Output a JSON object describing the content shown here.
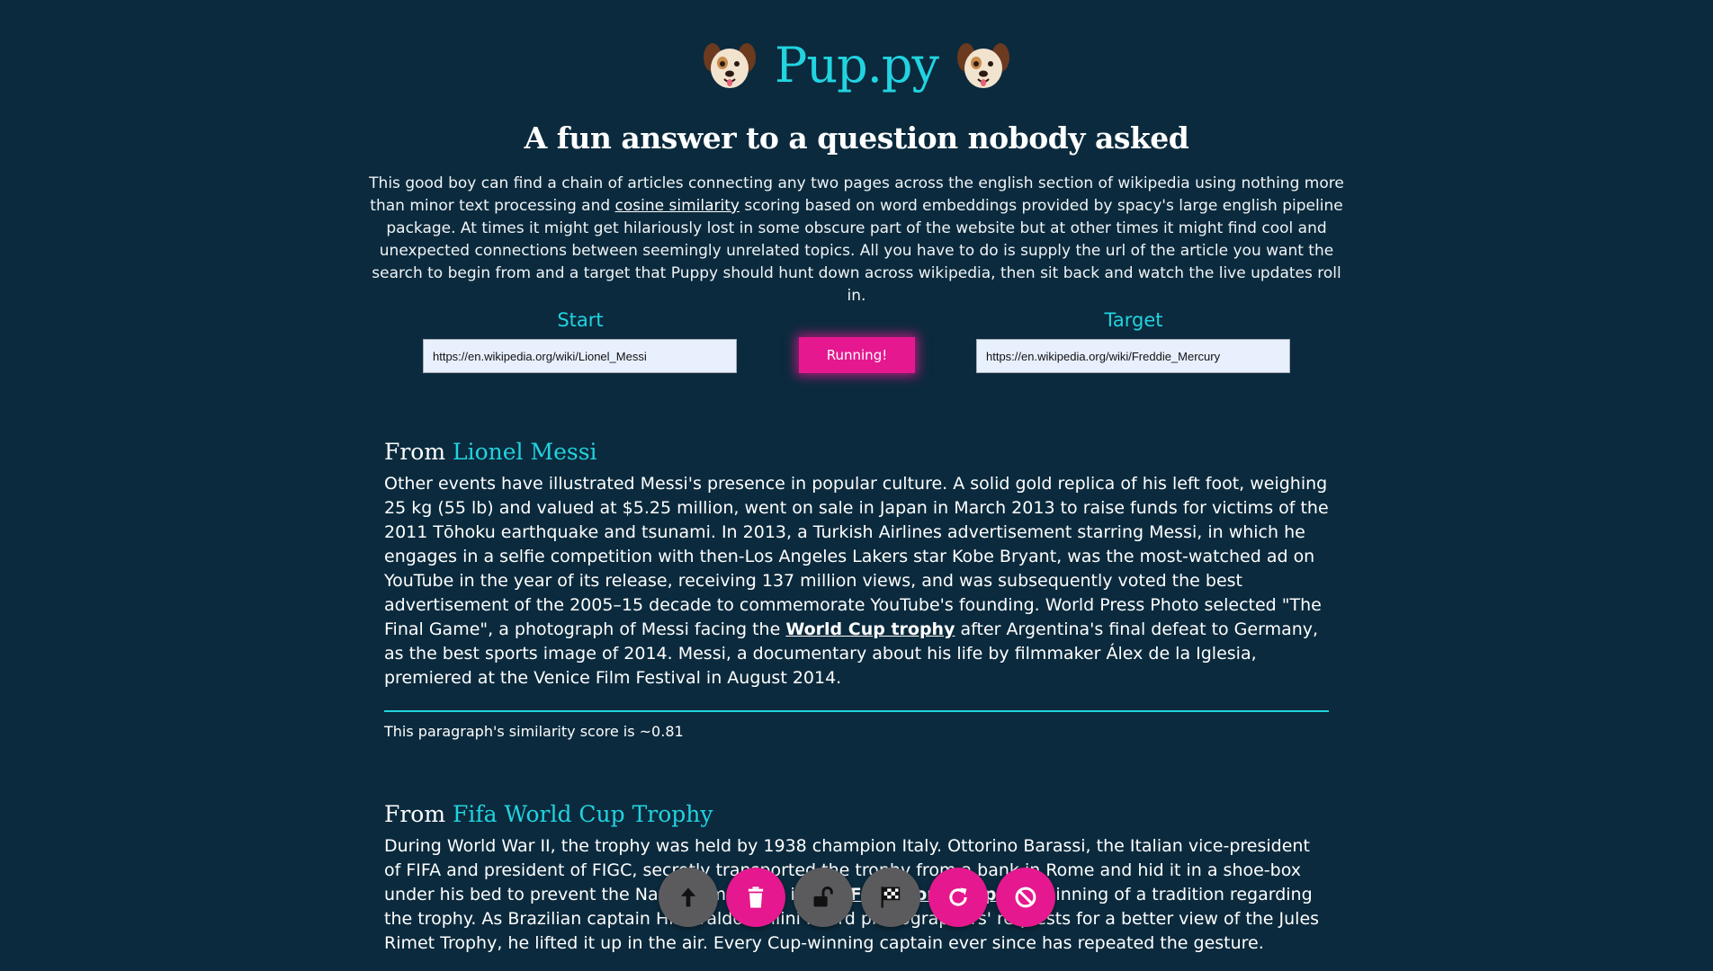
{
  "header": {
    "title": "Pup.py",
    "subtitle": "A fun answer to a question nobody asked",
    "intro_before_link": "This good boy can find a chain of articles connecting any two pages across the english section of wikipedia using nothing more than minor text processing and ",
    "intro_link": "cosine similarity",
    "intro_after_link": " scoring based on word embeddings provided by spacy's large english pipeline package. At times it might get hilariously lost in some obscure part of the website but at other times it might find cool and unexpected connections between seemingly unrelated topics. All you have to do is supply the url of the article you want the search to begin from and a target that Puppy should hunt down across wikipedia, then sit back and watch the live updates roll in."
  },
  "form": {
    "start_label": "Start",
    "start_value": "https://en.wikipedia.org/wiki/Lionel_Messi",
    "run_button": "Running!",
    "target_label": "Target",
    "target_value": "https://en.wikipedia.org/wiki/Freddie_Mercury"
  },
  "results": [
    {
      "from_prefix": "From ",
      "article": "Lionel Messi",
      "para_before": "Other events have illustrated Messi's presence in popular culture. A solid gold replica of his left foot, weighing 25 kg (55 lb) and valued at $5.25 million, went on sale in Japan in March 2013 to raise funds for victims of the 2011 Tōhoku earthquake and tsunami. In 2013, a Turkish Airlines advertisement starring Messi, in which he engages in a selfie competition with then-Los Angeles Lakers star Kobe Bryant, was the most-watched ad on YouTube in the year of its release, receiving 137 million views, and was subsequently voted the best advertisement of the 2005–15 decade to commemorate YouTube's founding. World Press Photo selected \"The Final Game\", a photograph of Messi facing the ",
      "para_link": "World Cup trophy",
      "para_after": " after Argentina's final defeat to Germany, as the best sports image of 2014. Messi, a documentary about his life by filmmaker Álex de la Iglesia, premiered at the Venice Film Festival in August 2014.",
      "score": "This paragraph's similarity score is ~0.81"
    },
    {
      "from_prefix": "From ",
      "article": "Fifa World Cup Trophy",
      "para_before": "During World War II, the trophy was held by 1938 champion Italy. Ottorino Barassi, the Italian vice-president of FIFA and president of FIGC, secretly transported the trophy from a bank in Rome and hid it in a shoe-box under his bed to prevent the Nazis from taking it. The ",
      "para_link": "FIFA World Cup",
      "para_after": " ... beginning of a tradition regarding the trophy. As Brazilian captain Hilderaldo Bellini heard photographers' requests for a better view of the Jules Rimet Trophy, he lifted it up in the air. Every Cup-winning captain ever since has repeated the gesture."
    }
  ],
  "fabs": [
    {
      "icon": "arrow-up-icon",
      "color": "#5b5b5e"
    },
    {
      "icon": "trash-icon",
      "color": "#e5188f"
    },
    {
      "icon": "unlock-icon",
      "color": "#5b5b5e"
    },
    {
      "icon": "checkered-flag-icon",
      "color": "#5b5b5e"
    },
    {
      "icon": "refresh-icon",
      "color": "#e5188f"
    },
    {
      "icon": "cancel-icon",
      "color": "#e5188f"
    }
  ],
  "colors": {
    "background": "#0b2a3d",
    "accent": "#22d3e0",
    "pink": "#e5188f",
    "grey_button": "#5b5b5e"
  }
}
